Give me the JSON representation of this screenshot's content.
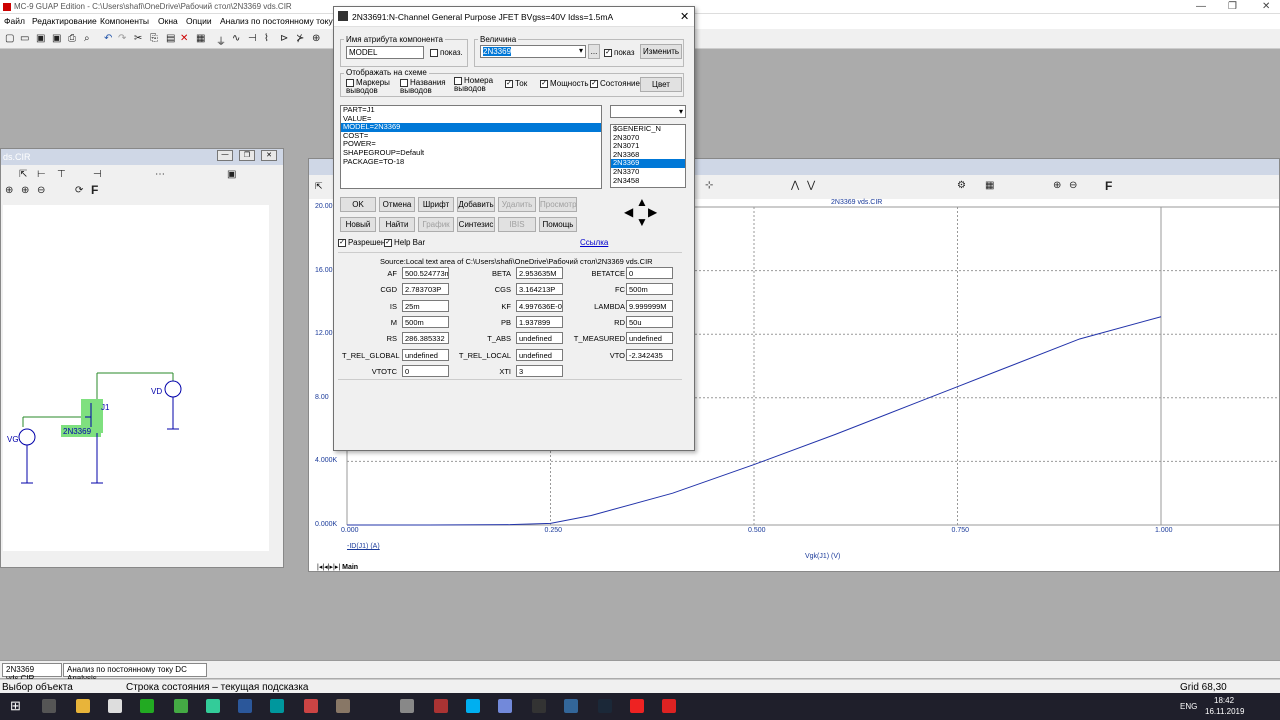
{
  "app": {
    "title": "MC-9 GUAP Edition - C:\\Users\\shafi\\OneDrive\\Рабочий стол\\2N3369 vds.CIR"
  },
  "menu": [
    "Файл",
    "Редактирование",
    "Компоненты",
    "Окна",
    "Опции",
    "Анализ по постоянному току DC"
  ],
  "schematic": {
    "title": "ds.CIR",
    "labels": {
      "vd": "VD",
      "vg": "VG",
      "j1": "J1",
      "model": "2N3369"
    }
  },
  "plot": {
    "title": "2N3369 vds.CIR",
    "xlabel": "Vgk(J1) (V)",
    "ylabel": "-ID(J1) (A)",
    "tab": "Main"
  },
  "chart_data": {
    "type": "line",
    "title": "2N3369 vds.CIR",
    "xlabel": "Vgk(J1) (V)",
    "ylabel": "-ID(J1) (A)",
    "xlim": [
      0,
      1
    ],
    "ylim": [
      0,
      0.02
    ],
    "x_ticks": [
      "0.000",
      "0.250",
      "0.500",
      "0.750",
      "1.000"
    ],
    "y_ticks": [
      "0.000K",
      "4.000K",
      "8.00",
      "12.00",
      "16.00",
      "20.00"
    ],
    "series": [
      {
        "x": [
          0,
          0.1,
          0.2,
          0.25,
          0.3,
          0.4,
          0.5,
          0.6,
          0.7,
          0.75,
          0.8,
          0.9,
          1.0
        ],
        "y": [
          0,
          0,
          2e-05,
          0.0001,
          0.0006,
          0.002,
          0.0038,
          0.0057,
          0.0077,
          0.0087,
          0.0097,
          0.0117,
          0.0131
        ]
      }
    ]
  },
  "dialog": {
    "title": "2N33691:N-Channel General Purpose JFET BVgss=40V Idss=1.5mA",
    "attr_group": "Имя атрибута компонента",
    "attr_name": "MODEL",
    "show1": "показ.",
    "value_group": "Величина",
    "value": "2N3369",
    "ellipsis": "...",
    "show2": "показ",
    "change": "Изменить",
    "display_group": "Отображать на схеме",
    "disp": [
      "Маркеры выводов",
      "Названия выводов",
      "Номера выводов",
      "Ток",
      "Мощность",
      "Состояние"
    ],
    "color": "Цвет",
    "attrs": [
      "PART=J1",
      "VALUE=",
      "MODEL=2N3369",
      "COST=",
      "POWER=",
      "SHAPEGROUP=Default",
      "PACKAGE=TO-18"
    ],
    "models": [
      "$GENERIC_N",
      "2N3070",
      "2N3071",
      "2N3368",
      "2N3369",
      "2N3370",
      "2N3458"
    ],
    "buttons1": [
      "OK",
      "Отмена",
      "Шрифт",
      "Добавить",
      "Удалить",
      "Просмотр"
    ],
    "buttons2": [
      "Новый",
      "Найти",
      "График",
      "Синтезис",
      "IBIS",
      "Помощь"
    ],
    "enable": "Разрешен",
    "helpbar": "Help Bar",
    "link": "Ссылка",
    "source": "Source:Local text area of C:\\Users\\shafi\\OneDrive\\Рабочий стол\\2N3369 vds.CIR",
    "params": [
      [
        "AF",
        "500.524773m",
        "BETA",
        "2.953635M",
        "BETATCE",
        "0"
      ],
      [
        "CGD",
        "2.783703P",
        "CGS",
        "3.164213P",
        "FC",
        "500m"
      ],
      [
        "IS",
        "25m",
        "KF",
        "4.997636E-0",
        "LAMBDA",
        "9.999999M"
      ],
      [
        "M",
        "500m",
        "PB",
        "1.937899",
        "RD",
        "50u"
      ],
      [
        "RS",
        "286.385332",
        "T_ABS",
        "undefined",
        "T_MEASURED",
        "undefined"
      ],
      [
        "T_REL_GLOBAL",
        "undefined",
        "T_REL_LOCAL",
        "undefined",
        "VTO",
        "-2.342435"
      ],
      [
        "VTOTC",
        "0",
        "XTI",
        "3",
        "",
        ""
      ]
    ]
  },
  "tabs": [
    "2N3369 vds.CIR",
    "Анализ по постоянному току DC Analysis"
  ],
  "status": {
    "left": "Выбор объекта",
    "hint": "Строка состояния – текущая подсказка",
    "grid": "Grid 68,30"
  },
  "tray": {
    "lang": "ENG",
    "time": "18:42",
    "date": "16.11.2019"
  }
}
